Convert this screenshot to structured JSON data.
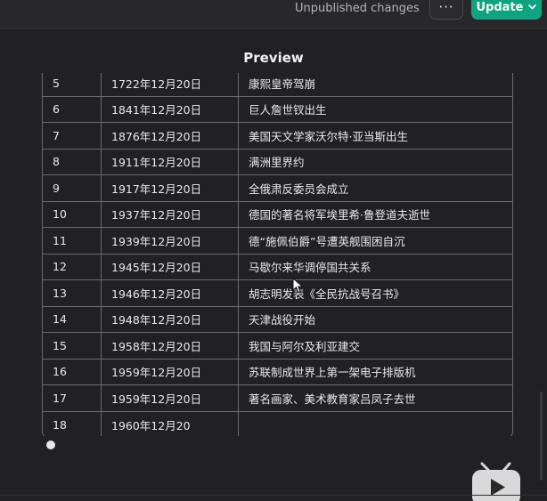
{
  "header": {
    "status": "Unpublished changes",
    "more_label": "···",
    "update_label": "Update"
  },
  "preview": {
    "title": "Preview"
  },
  "table": {
    "rows": [
      {
        "num": "5",
        "date": "1722年12月20日",
        "event": "康熙皇帝驾崩"
      },
      {
        "num": "6",
        "date": "1841年12月20日",
        "event": "巨人詹世钗出生"
      },
      {
        "num": "7",
        "date": "1876年12月20日",
        "event": "美国天文学家沃尔特·亚当斯出生"
      },
      {
        "num": "8",
        "date": "1911年12月20日",
        "event": "满洲里界约"
      },
      {
        "num": "9",
        "date": "1917年12月20日",
        "event": "全俄肃反委员会成立"
      },
      {
        "num": "10",
        "date": "1937年12月20日",
        "event": "德国的著名将军埃里希·鲁登道夫逝世"
      },
      {
        "num": "11",
        "date": "1939年12月20日",
        "event": "德“施佩伯爵”号遭英舰围困自沉"
      },
      {
        "num": "12",
        "date": "1945年12月20日",
        "event": "马歇尔来华调停国共关系"
      },
      {
        "num": "13",
        "date": "1946年12月20日",
        "event": "胡志明发表《全民抗战号召书》"
      },
      {
        "num": "14",
        "date": "1948年12月20日",
        "event": "天津战役开始"
      },
      {
        "num": "15",
        "date": "1958年12月20日",
        "event": "我国与阿尔及利亚建交"
      },
      {
        "num": "16",
        "date": "1959年12月20日",
        "event": "苏联制成世界上第一架电子排版机"
      },
      {
        "num": "17",
        "date": "1959年12月20日",
        "event": "著名画家、美术教育家吕凤子去世"
      },
      {
        "num": "18",
        "date": "1960年12月20",
        "event": ""
      }
    ]
  },
  "colors": {
    "background": "#212124",
    "accent": "#10a37f",
    "border": "#6a6a70"
  },
  "icons": {
    "more": "ellipsis-icon",
    "update_caret": "chevron-down-icon",
    "cursor": "mouse-cursor-icon",
    "video": "tv-video-icon"
  }
}
